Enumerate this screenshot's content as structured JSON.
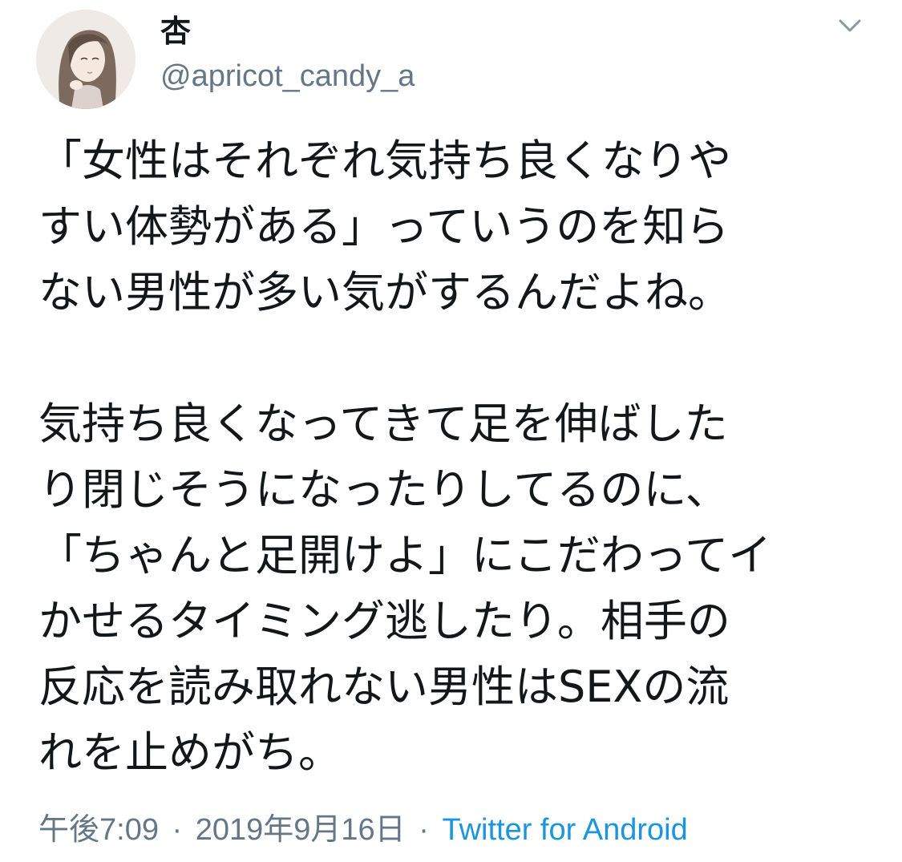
{
  "tweet": {
    "display_name": "杏",
    "username": "@apricot_candy_a",
    "avatar_icon": "user-avatar-illustration",
    "menu_icon": "chevron-down-icon",
    "text_lines": [
      "「女性はそれぞれ気持ち良くなりや",
      "すい体勢がある」っていうのを知ら",
      "ない男性が多い気がするんだよね。",
      "",
      "気持ち良くなってきて足を伸ばした",
      "り閉じそうになったりしてるのに、",
      "「ちゃんと足開けよ」にこだわってイ",
      "かせるタイミング逃したり。相手の",
      "反応を読み取れない男性はSEXの流",
      "れを止めがち。"
    ],
    "time": "午後7:09",
    "date": "2019年9月16日",
    "source": "Twitter for Android",
    "separator": "·",
    "colors": {
      "text": "#14171a",
      "secondary": "#657786",
      "link": "#1b95e0"
    }
  }
}
